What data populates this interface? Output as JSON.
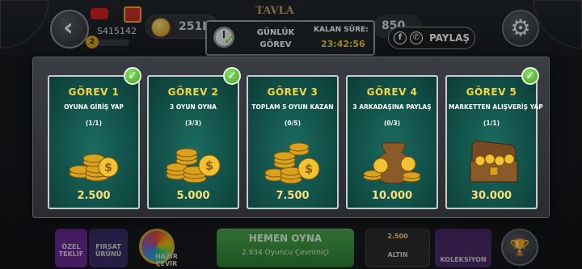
{
  "header": {
    "player_id": "S415142",
    "level": "2",
    "coins": "251K",
    "tavla_sign": "TAVLA",
    "right_amount": "850",
    "task_label_line1": "GÜNLÜK",
    "task_label_line2": "GÖREV",
    "remaining_label": "KALAN SÜRE:",
    "remaining_time": "23:42:56",
    "share_label": "PAYLAŞ",
    "share_icons": [
      "facebook-icon",
      "whatsapp-icon"
    ]
  },
  "tasks": [
    {
      "title": "GÖREV 1",
      "description": "OYUNA GİRİŞ YAP",
      "progress": "(1/1)",
      "reward": "2.500",
      "completed": true
    },
    {
      "title": "GÖREV 2",
      "description": "3 OYUN OYNA",
      "progress": "(3/3)",
      "reward": "5.000",
      "completed": true
    },
    {
      "title": "GÖREV 3",
      "description": "TOPLAM 5 OYUN KAZAN",
      "progress": "(0/5)",
      "reward": "7.500",
      "completed": false
    },
    {
      "title": "GÖREV 4",
      "description": "3 ARKADAŞINA PAYLAŞ",
      "progress": "(0/3)",
      "reward": "10.000",
      "completed": false
    },
    {
      "title": "GÖREV 5",
      "description": "MARKETTEN ALIŞVERİŞ YAP",
      "progress": "(1/1)",
      "reward": "30.000",
      "completed": true
    }
  ],
  "bottom": {
    "ozel_line1": "ÖZEL",
    "ozel_line2": "TEKLİF",
    "firsat_line1": "FIRSAT",
    "firsat_line2": "ÜRÜNÜ",
    "hazir_line1": "HAZIR",
    "hazir_line2": "ÇEVİR",
    "play_label": "HEMEN OYNA",
    "online_count": "2.934 Oyuncu Çevrimiçi",
    "altin_amount": "2.500",
    "altin_label": "ALTIN",
    "koleksiyon_label": "KOLEKSİYON"
  },
  "colors": {
    "card_bg": "#12524a",
    "title_yellow": "#f9d43a",
    "reward_yellow": "#f9e27a",
    "check_green": "#3f9e1f"
  }
}
